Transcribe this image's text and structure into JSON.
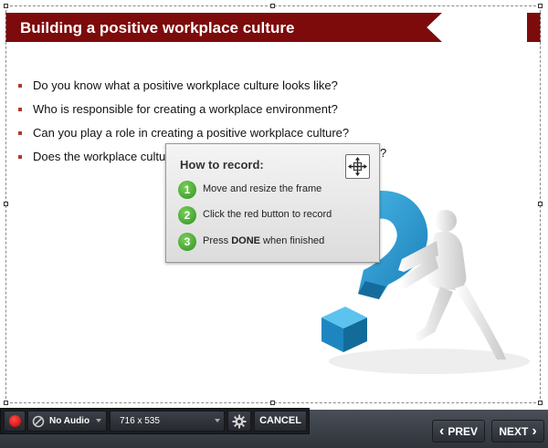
{
  "slide": {
    "title": "Building a positive workplace culture",
    "bullets": [
      "Do you know what a positive workplace culture looks like?",
      "Who is responsible for creating a workplace environment?",
      "Can you play a role in creating a positive workplace culture?",
      "Does the workplace cultu",
      "?"
    ],
    "illustration_icon": "question-mark-figure-illustration"
  },
  "popup": {
    "title": "How to record:",
    "move_icon": "move-arrows-icon",
    "steps": [
      {
        "number": "1",
        "text": "Move and resize the frame"
      },
      {
        "number": "2",
        "text": "Click the red button to record"
      },
      {
        "number": "3",
        "text_before": "Press ",
        "text_bold": "DONE",
        "text_after": " when finished"
      }
    ]
  },
  "toolbar": {
    "record_icon": "record-icon",
    "audio_label": "No Audio",
    "audio_icon": "mute-icon",
    "size_label": "716 x 535",
    "settings_icon": "gear-icon",
    "cancel_label": "CANCEL"
  },
  "navigation": {
    "prev_label": "PREV",
    "next_label": "NEXT",
    "prev_glyph": "‹",
    "next_glyph": "›"
  },
  "colors": {
    "title_banner": "#7d0b0b",
    "bullet": "#b23a2e",
    "step_badge": "#3fa52c",
    "record": "#e00000"
  }
}
